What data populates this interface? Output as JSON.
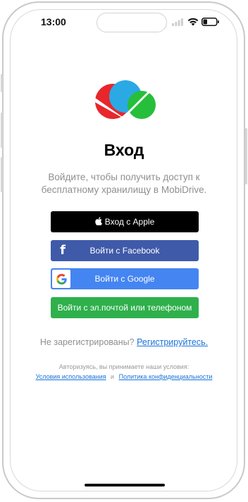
{
  "status_bar": {
    "time": "13:00",
    "icons": [
      "signal-icon",
      "wifi-icon",
      "battery-icon"
    ]
  },
  "login": {
    "title": "Вход",
    "subtitle": "Войдите, чтобы получить доступ к бесплатному хранилищу в MobiDrive.",
    "buttons": {
      "apple": "Вход с Apple",
      "facebook": "Войти с Facebook",
      "google": "Войти с Google",
      "email": "Войти с эл.почтой или телефоном"
    },
    "register_prompt": "Не зарегистрированы?",
    "register_link": "Регистрируйтесь.",
    "terms_text": "Авторизуясь, вы принимаете наши условия:",
    "terms_link": "Условия использования",
    "conjunction": "и",
    "privacy_link": "Политика конфиденциальности"
  },
  "colors": {
    "apple": "#000000",
    "facebook": "#3f5aa9",
    "google": "#4585f2",
    "email": "#2fb04c",
    "link": "#1a73d9"
  }
}
